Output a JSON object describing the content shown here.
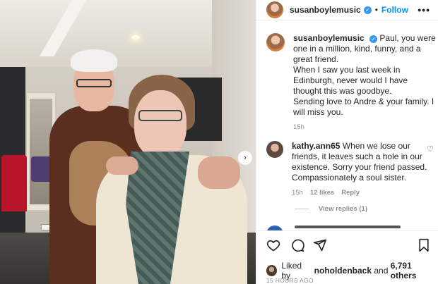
{
  "post": {
    "username": "susanboylemusic",
    "follow_label": "Follow",
    "more_label": "•••",
    "dot": "•"
  },
  "caption": {
    "username": "susanboylemusic",
    "lines": [
      "Paul, you were one in a million, kind, funny, and a great friend.",
      "When I saw you last week in Edinburgh, never would I have thought this was goodbye.",
      "Sending love to Andre & your family. I will miss you."
    ],
    "time": "15h"
  },
  "comment": {
    "username": "kathy.ann65",
    "text": "When we lose our friends, it leaves such a hole in our existence. Sorry your friend passed. Compassionately a soul sister.",
    "time": "15h",
    "likes": "12 likes",
    "reply": "Reply"
  },
  "view_replies": "View replies (1)",
  "likes": {
    "prefix": "Liked by",
    "user": "noholdenback",
    "connector": "and",
    "count": "6,791 others"
  },
  "timestamp": "15 HOURS AGO",
  "icons": [
    "heart-icon",
    "comment-icon",
    "share-icon",
    "bookmark-icon",
    "verified-icon",
    "chevron-right-icon"
  ],
  "colors": {
    "accent": "#0095f6",
    "verified": "#3897f0",
    "muted": "#8e8e8e"
  }
}
